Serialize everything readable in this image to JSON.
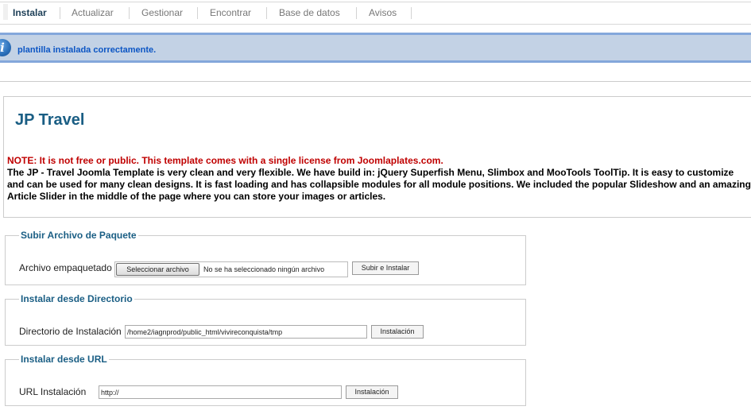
{
  "tabs": [
    {
      "label": "Instalar",
      "active": true
    },
    {
      "label": "Actualizar"
    },
    {
      "label": "Gestionar"
    },
    {
      "label": "Encontrar"
    },
    {
      "label": "Base de datos"
    },
    {
      "label": "Avisos"
    }
  ],
  "message": {
    "text": "plantilla instalada correctamente.",
    "icon": "info-icon"
  },
  "template": {
    "title": "JP Travel",
    "note": "NOTE: It is not free or public. This template comes with a single license from Joomlaplates.com.",
    "description": "The JP - Travel Joomla Template is very clean and very flexible. We have build in: jQuery Superfish Menu, Slimbox and MooTools ToolTip. It is easy to customize and can be used for many clean designs. It is fast loading and has collapsible modules for all module positions. We included the popular Slideshow and an amazing Article Slider in the middle of the page where you can store your images or articles."
  },
  "upload": {
    "legend": "Subir Archivo de Paquete",
    "label": "Archivo empaquetado",
    "file_button": "Seleccionar archivo",
    "file_status": "No se ha seleccionado ningún archivo",
    "submit": "Subir e Instalar"
  },
  "directory": {
    "legend": "Instalar desde Directorio",
    "label": "Directorio de Instalación",
    "value": "/home2/iagnprod/public_html/vivireconquista/tmp",
    "submit": "Instalación"
  },
  "url": {
    "legend": "Instalar desde URL",
    "label": "URL Instalación",
    "value": "http://",
    "submit": "Instalación"
  },
  "colors": {
    "accent": "#1a5e84",
    "message_bg": "#c3d2e5",
    "note": "#c00000"
  }
}
